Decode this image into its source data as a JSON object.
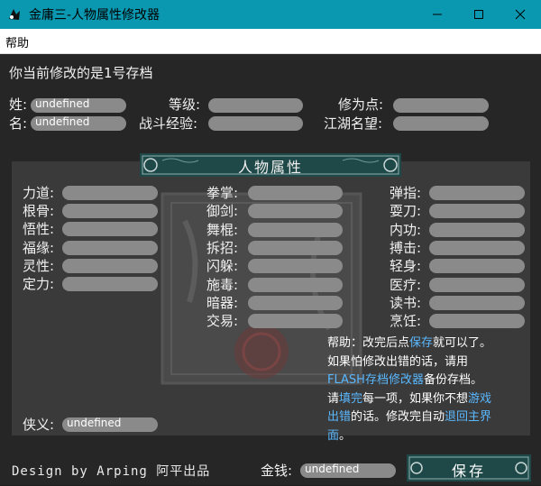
{
  "window": {
    "title": "金庸三-人物属性修改器"
  },
  "menu": {
    "help": "帮助"
  },
  "status_text": "你当前修改的是1号存档",
  "basic": {
    "surname": {
      "label": "姓:",
      "value": "undefined"
    },
    "given_name": {
      "label": "名:",
      "value": "undefined"
    },
    "level": {
      "label": "等级:",
      "value": ""
    },
    "combat_exp": {
      "label": "战斗经验:",
      "value": ""
    },
    "cultivation": {
      "label": "修为点:",
      "value": ""
    },
    "reputation": {
      "label": "江湖名望:",
      "value": ""
    }
  },
  "section_title": "人物属性",
  "attributes": [
    {
      "label": "力道:",
      "value": ""
    },
    {
      "label": "根骨:",
      "value": ""
    },
    {
      "label": "悟性:",
      "value": ""
    },
    {
      "label": "福缘:",
      "value": ""
    },
    {
      "label": "灵性:",
      "value": ""
    },
    {
      "label": "定力:",
      "value": ""
    }
  ],
  "skills_mid": [
    {
      "label": "拳掌:",
      "value": ""
    },
    {
      "label": "御剑:",
      "value": ""
    },
    {
      "label": "舞棍:",
      "value": ""
    },
    {
      "label": "拆招:",
      "value": ""
    },
    {
      "label": "闪躲:",
      "value": ""
    },
    {
      "label": "施毒:",
      "value": ""
    },
    {
      "label": "暗器:",
      "value": ""
    },
    {
      "label": "交易:",
      "value": ""
    }
  ],
  "skills_right": [
    {
      "label": "弹指:",
      "value": ""
    },
    {
      "label": "耍刀:",
      "value": ""
    },
    {
      "label": "内功:",
      "value": ""
    },
    {
      "label": "搏击:",
      "value": ""
    },
    {
      "label": "轻身:",
      "value": ""
    },
    {
      "label": "医疗:",
      "value": ""
    },
    {
      "label": "读书:",
      "value": ""
    },
    {
      "label": "烹饪:",
      "value": ""
    }
  ],
  "chivalry": {
    "label": "侠义:",
    "value": "undefined"
  },
  "help_text": {
    "line1_pre": "帮助：改完后点",
    "line1_link": "保存",
    "line1_post": "就可以了。",
    "line2": "如果怕修改出错的话，请用",
    "line3_link": "FLASH存档修改器",
    "line3_post": "备份存档。",
    "line4_pre": "请",
    "line4_hl": "填完",
    "line4_mid": "每一项，如果你不想",
    "line4_link": "游戏",
    "line5_link": "出错",
    "line5_mid": "的话。修改完自动",
    "line5_link2": "退回主界",
    "line6_link": "面",
    "line6_post": "。"
  },
  "footer": {
    "credit": "Design by Arping 阿平出品",
    "money_label": "金钱:",
    "money_value": "undefined",
    "save_label": "保存"
  },
  "colors": {
    "titlebar": "#0a97b0",
    "background": "#262626",
    "panel": "#3a3a3a",
    "field": "#8a8a8a",
    "link": "#5ab8ff"
  }
}
